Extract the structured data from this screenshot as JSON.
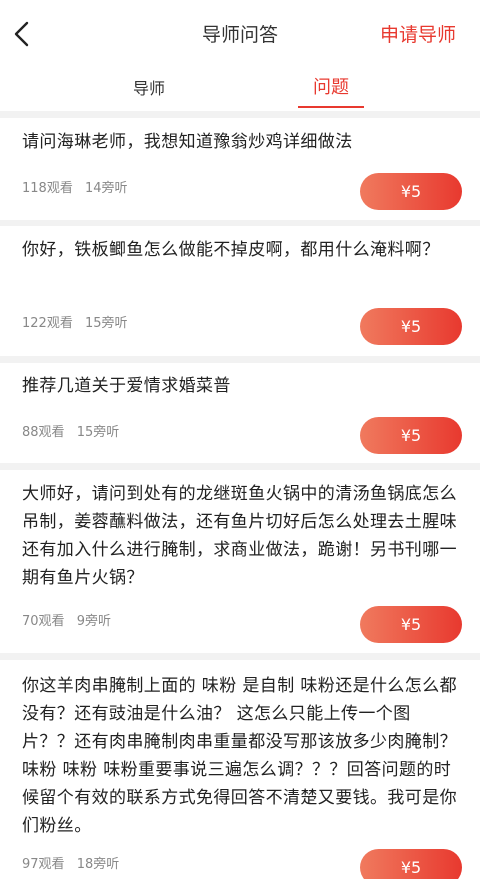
{
  "header": {
    "title": "导师问答",
    "apply_label": "申请导师"
  },
  "tabs": {
    "mentor": "导师",
    "question": "问题"
  },
  "questions": [
    {
      "text": "请问海琳老师，我想知道豫翁炒鸡详细做法",
      "views": "118观看",
      "listens": "14旁听",
      "price": "¥5"
    },
    {
      "text": "你好，铁板鲫鱼怎么做能不掉皮啊，都用什么淹料啊？",
      "views": "122观看",
      "listens": "15旁听",
      "price": "¥5"
    },
    {
      "text": "推荐几道关于爱情求婚菜普",
      "views": "88观看",
      "listens": "15旁听",
      "price": "¥5"
    },
    {
      "text": "大师好，请问到处有的龙继斑鱼火锅中的清汤鱼锅底怎么吊制，姜蓉蘸料做法，还有鱼片切好后怎么处理去土腥味还有加入什么进行腌制，求商业做法，跪谢！另书刊哪一期有鱼片火锅？",
      "views": "70观看",
      "listens": "9旁听",
      "price": "¥5"
    },
    {
      "text": "你这羊肉串腌制上面的 味粉 是自制 味粉还是什么怎么都没有？还有豉油是什么油？ 这怎么只能上传一个图片？？还有肉串腌制肉串重量都没写那该放多少肉腌制？味粉 味粉 味粉重要事说三遍怎么调？？？回答问题的时候留个有效的联系方式免得回答不清楚又要钱。我可是你们粉丝。",
      "views": "97观看",
      "listens": "18旁听",
      "price": "¥5"
    }
  ]
}
